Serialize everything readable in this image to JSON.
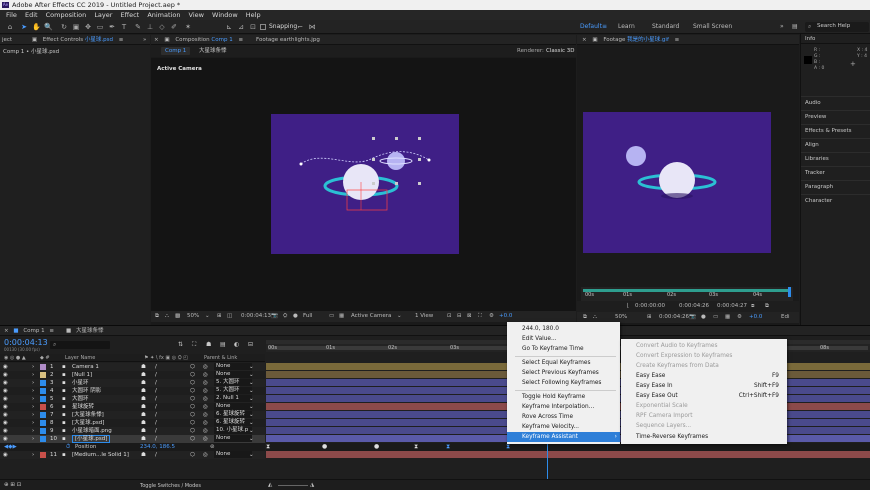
{
  "app": {
    "title": "Adobe After Effects CC 2019 - Untitled Project.aep *",
    "logo": "Ae"
  },
  "menu": [
    "File",
    "Edit",
    "Composition",
    "Layer",
    "Effect",
    "Animation",
    "View",
    "Window",
    "Help"
  ],
  "toolbar": {
    "snapping": "Snapping",
    "workspaces": [
      "Default",
      "Learn",
      "Standard",
      "Small Screen"
    ],
    "active_workspace": "Default",
    "search": "Search Help"
  },
  "project_panel": {
    "tab": "ject",
    "effect_controls_label": "Effect Controls",
    "effect_controls_target": "小星球.psd",
    "subtitle": "Comp 1 • 小星球.psd"
  },
  "comp_panel": {
    "tab_prefix": "Composition",
    "tab_name": "Comp 1",
    "footage_tab": "Footage earthlights.jpg",
    "sub_tabs": [
      "Comp 1",
      "大星球条悸"
    ],
    "renderer_label": "Renderer:",
    "renderer": "Classic 3D",
    "active_camera_label": "Active Camera",
    "zoom": "50%",
    "timecode": "0:00:04:13",
    "resolution": "Full",
    "view": "Active Camera",
    "views": "1 View",
    "exposure": "+0.0"
  },
  "footage_panel": {
    "tab_prefix": "Footage",
    "tab_name": "我是的小星球.gif",
    "zoom": "50%",
    "tc1": "0:00:00:00",
    "tc2": "0:00:04:26",
    "tc3": "0:00:04:27",
    "exposure": "+0.0",
    "edit": "Edi",
    "ruler": [
      "00s",
      "01s",
      "02s",
      "03s",
      "04s"
    ]
  },
  "right_panel": {
    "info": "Info",
    "rgba": [
      "R :",
      "G :",
      "B :",
      "A : 0"
    ],
    "xy": [
      "X : 4",
      "Y : 4"
    ],
    "items": [
      "Audio",
      "Preview",
      "Effects & Presets",
      "Align",
      "Libraries",
      "Tracker",
      "Paragraph",
      "Character"
    ]
  },
  "timeline": {
    "tab": "Comp 1",
    "tab2": "大星球条悸",
    "timecode": "0:00:04:13",
    "timecode_sub": "00130 (30.00 fps)",
    "col_layer": "Layer Name",
    "col_parent": "Parent & Link",
    "ruler": [
      "00s",
      "01s",
      "02s",
      "03s",
      "04s",
      "05s",
      "06s",
      "07s",
      "08s"
    ],
    "toggle": "Toggle Switches / Modes",
    "position_label": "Position",
    "position_value": "234.0, 186.5",
    "layers": [
      {
        "num": "1",
        "name": "Camera 1",
        "parent": "None"
      },
      {
        "num": "2",
        "name": "[Null 1]",
        "parent": "None"
      },
      {
        "num": "3",
        "name": "小星环",
        "parent": "5. 大圆环"
      },
      {
        "num": "4",
        "name": "大圆环 阴影",
        "parent": "5. 大圆环"
      },
      {
        "num": "5",
        "name": "大圆环",
        "parent": "2. Null 1"
      },
      {
        "num": "6",
        "name": "星球旋转",
        "parent": "None"
      },
      {
        "num": "7",
        "name": "[大星球条悸]",
        "parent": "6. 星球旋转"
      },
      {
        "num": "8",
        "name": "[大星球.psd]",
        "parent": "6. 星球旋转"
      },
      {
        "num": "9",
        "name": "小星球暗面.png",
        "parent": "10. 小星球.p"
      },
      {
        "num": "10",
        "name": "[小星球.psd]",
        "parent": "None"
      },
      {
        "num": "11",
        "name": "[Medium...le Solid 1]",
        "parent": "None"
      }
    ]
  },
  "context_menu": {
    "items": [
      "244.0, 180.0",
      "Edit Value...",
      "Go To Keyframe Time",
      "Select Equal Keyframes",
      "Select Previous Keyframes",
      "Select Following Keyframes",
      "Toggle Hold Keyframe",
      "Keyframe Interpolation...",
      "Rove Across Time",
      "Keyframe Velocity...",
      "Keyframe Assistant"
    ],
    "highlight": "Keyframe Assistant"
  },
  "submenu": {
    "items": [
      {
        "label": "Convert Audio to Keyframes",
        "shortcut": "",
        "enabled": false
      },
      {
        "label": "Convert Expression to Keyframes",
        "shortcut": "",
        "enabled": false
      },
      {
        "label": "Create Keyframes from Data",
        "shortcut": "",
        "enabled": false
      },
      {
        "label": "Easy Ease",
        "shortcut": "F9",
        "enabled": true
      },
      {
        "label": "Easy Ease In",
        "shortcut": "Shift+F9",
        "enabled": true
      },
      {
        "label": "Easy Ease Out",
        "shortcut": "Ctrl+Shift+F9",
        "enabled": true
      },
      {
        "label": "Exponential Scale",
        "shortcut": "",
        "enabled": false
      },
      {
        "label": "RPF Camera Import",
        "shortcut": "",
        "enabled": false
      },
      {
        "label": "Sequence Layers...",
        "shortcut": "",
        "enabled": false
      },
      {
        "label": "Time-Reverse Keyframes",
        "shortcut": "",
        "enabled": true
      }
    ]
  },
  "colors": {
    "accent": "#2d8ceb",
    "comp_bg": "#3f1f86",
    "highlight": "#2e7fd8"
  }
}
